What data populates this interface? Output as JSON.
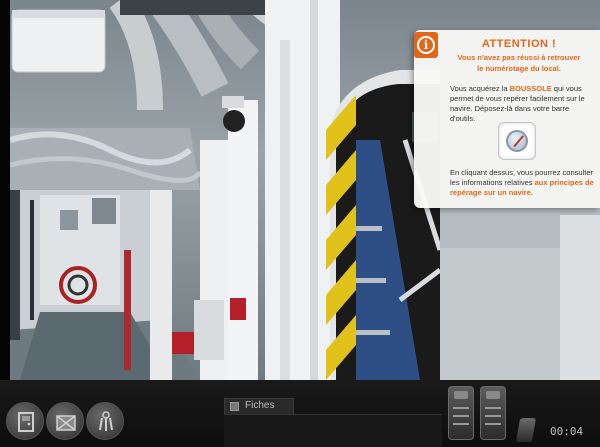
{
  "notification": {
    "title": "ATTENTION !",
    "subtitle_line1": "Vous n'avez pas réussi à retrouver",
    "subtitle_line2": "le numérotage du local.",
    "body1_pre": "Vous acquérez la ",
    "body1_highlight": "BOUSSOLE",
    "body1_post": " qui vous permet de vous repérer facilement sur le navire. Déposez-là dans votre barre d'outils.",
    "body2_pre": "En cliquant dessus,  vous pourrez consulter les informations relatives ",
    "body2_highlight": "aux principes de repérage sur un navire.",
    "item_icon": "compass-icon",
    "accent_color": "#e2661a"
  },
  "toolbar": {
    "tools": [
      "door-icon",
      "crate-icon",
      "keys-icon"
    ],
    "fiches_label": "Fiches",
    "time": "00:04"
  }
}
